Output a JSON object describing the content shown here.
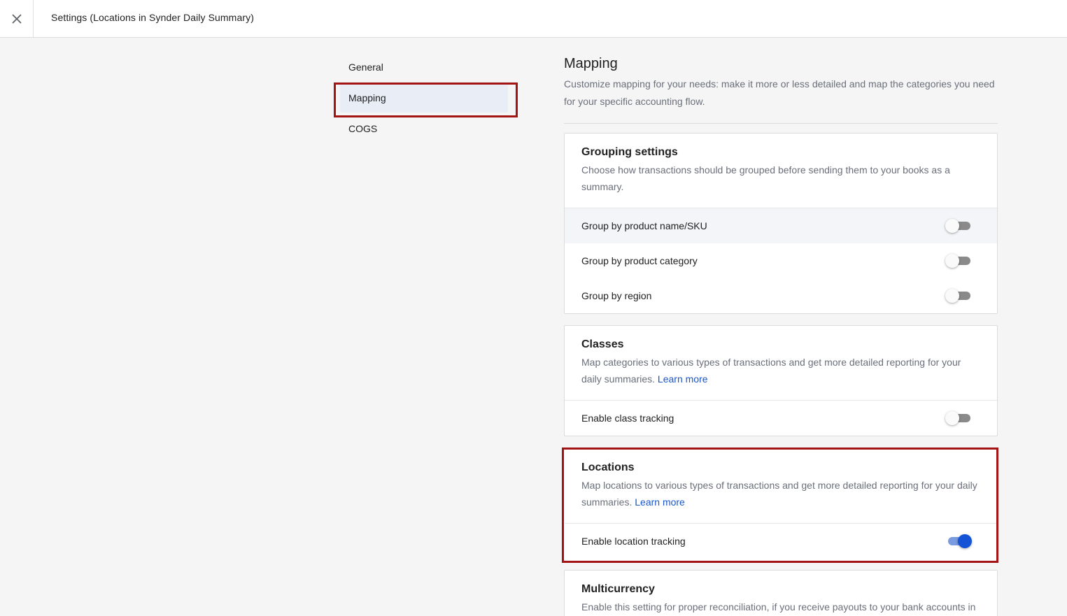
{
  "window": {
    "title": "Settings (Locations in Synder Daily Summary)"
  },
  "icons": {
    "close": "close-icon"
  },
  "colors": {
    "accent": "#1452d6",
    "highlight_border": "#a31515",
    "link": "#1a56c8"
  },
  "nav": {
    "items": [
      {
        "label": "General"
      },
      {
        "label": "Mapping",
        "active": true
      },
      {
        "label": "COGS"
      }
    ]
  },
  "main": {
    "title": "Mapping",
    "description": "Customize mapping for your needs: make it more or less detailed and map the categories you need for your specific accounting flow."
  },
  "grouping": {
    "title": "Grouping settings",
    "description": "Choose how transactions should be grouped before sending them to your books as a summary.",
    "rows": [
      {
        "label": "Group by product name/SKU",
        "enabled": false
      },
      {
        "label": "Group by product category",
        "enabled": false
      },
      {
        "label": "Group by region",
        "enabled": false
      }
    ]
  },
  "classes": {
    "title": "Classes",
    "description": "Map categories to various types of transactions and get more detailed reporting for your daily summaries.",
    "link": "Learn more",
    "row": {
      "label": "Enable class tracking",
      "enabled": false
    }
  },
  "locations": {
    "title": "Locations",
    "description": "Map locations to various types of transactions and get more detailed reporting for your daily summaries.",
    "link": "Learn more",
    "row": {
      "label": "Enable location tracking",
      "enabled": true
    }
  },
  "multicurrency": {
    "title": "Multicurrency",
    "description": "Enable this setting for proper reconciliation, if you receive payouts to your bank accounts in"
  }
}
